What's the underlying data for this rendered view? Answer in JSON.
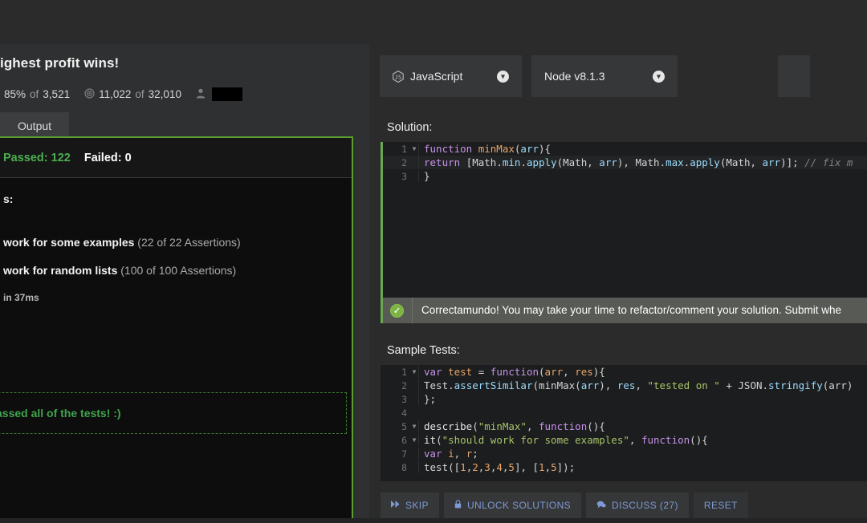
{
  "kata": {
    "title_truncated": "ighest profit wins!",
    "stats": {
      "completion_icon": "thumbs-up-icon",
      "completion": "85%",
      "completion_of": "of",
      "completion_total": "3,521",
      "rank_icon": "target-icon",
      "rank_value": "11,022",
      "rank_of": "of",
      "rank_total": "32,010",
      "user_icon": "person-icon",
      "user_name_redacted": ""
    }
  },
  "left_panel": {
    "tabs": [
      {
        "label": "Output",
        "active": true
      }
    ],
    "summary": {
      "passed_label": "Passed: 122",
      "failed_label": "Failed: 0"
    },
    "results_heading_truncated": "s:",
    "results": [
      {
        "name_truncated": "work for some examples",
        "assertions": "(22 of 22 Assertions)"
      },
      {
        "name_truncated": "work for random lists",
        "assertions": "(100 of 100 Assertions)"
      }
    ],
    "time_truncated": "in 37ms",
    "success_message_truncated": "assed all of the tests! :)"
  },
  "right_panel": {
    "selectors": [
      {
        "icon": "javascript-icon",
        "label": "JavaScript",
        "chevron": "chevron-down-icon"
      },
      {
        "icon": "",
        "label": "Node v8.1.3",
        "chevron": "chevron-down-icon"
      }
    ],
    "solution_label": "Solution:",
    "samples_label": "Sample Tests:",
    "solution_code": [
      {
        "num": "1",
        "fold": true,
        "highlight": false,
        "tokens": [
          {
            "t": "function ",
            "c": "k"
          },
          {
            "t": "minMax",
            "c": "nm"
          },
          {
            "t": "(",
            "c": "pn"
          },
          {
            "t": "arr",
            "c": "fn"
          },
          {
            "t": "){",
            "c": "pn"
          }
        ]
      },
      {
        "num": "2",
        "fold": false,
        "highlight": true,
        "tokens": [
          {
            "t": "  return ",
            "c": "k"
          },
          {
            "t": "[Math",
            "c": "pn"
          },
          {
            "t": ".",
            "c": "pn"
          },
          {
            "t": "min",
            "c": "fn"
          },
          {
            "t": ".",
            "c": "pn"
          },
          {
            "t": "apply",
            "c": "fn"
          },
          {
            "t": "(Math, ",
            "c": "pn"
          },
          {
            "t": "arr",
            "c": "fn"
          },
          {
            "t": "), Math",
            "c": "pn"
          },
          {
            "t": ".",
            "c": "pn"
          },
          {
            "t": "max",
            "c": "fn"
          },
          {
            "t": ".",
            "c": "pn"
          },
          {
            "t": "apply",
            "c": "fn"
          },
          {
            "t": "(Math, ",
            "c": "pn"
          },
          {
            "t": "arr",
            "c": "fn"
          },
          {
            "t": ")]; ",
            "c": "pn"
          },
          {
            "t": "// fix m",
            "c": "cm"
          }
        ]
      },
      {
        "num": "3",
        "fold": false,
        "highlight": false,
        "tokens": [
          {
            "t": "}",
            "c": "pn"
          }
        ]
      }
    ],
    "correct_message_truncated": "Correctamundo! You may take your time to refactor/comment your solution. Submit whe",
    "correct_icon": "check-circle-icon",
    "sample_code": [
      {
        "num": "1",
        "fold": true,
        "highlight": false,
        "tokens": [
          {
            "t": "var ",
            "c": "k"
          },
          {
            "t": "test",
            "c": "nm"
          },
          {
            "t": " = ",
            "c": "pn"
          },
          {
            "t": "function",
            "c": "k"
          },
          {
            "t": "(",
            "c": "pn"
          },
          {
            "t": "arr",
            "c": "nm"
          },
          {
            "t": ", ",
            "c": "pn"
          },
          {
            "t": "res",
            "c": "nm"
          },
          {
            "t": "){",
            "c": "pn"
          }
        ]
      },
      {
        "num": "2",
        "fold": false,
        "highlight": false,
        "tokens": [
          {
            "t": "  Test",
            "c": "pn"
          },
          {
            "t": ".",
            "c": "pn"
          },
          {
            "t": "assertSimilar",
            "c": "fn"
          },
          {
            "t": "(minMax(",
            "c": "pn"
          },
          {
            "t": "arr",
            "c": "fn"
          },
          {
            "t": "), ",
            "c": "pn"
          },
          {
            "t": "res",
            "c": "fn"
          },
          {
            "t": ", ",
            "c": "pn"
          },
          {
            "t": "\"tested on \"",
            "c": "st"
          },
          {
            "t": " + JSON",
            "c": "pn"
          },
          {
            "t": ".",
            "c": "pn"
          },
          {
            "t": "stringify",
            "c": "fn"
          },
          {
            "t": "(arr)",
            "c": "pn"
          }
        ]
      },
      {
        "num": "3",
        "fold": false,
        "highlight": false,
        "tokens": [
          {
            "t": "};",
            "c": "pn"
          }
        ]
      },
      {
        "num": "4",
        "fold": false,
        "highlight": false,
        "tokens": [
          {
            "t": "",
            "c": "pn"
          }
        ]
      },
      {
        "num": "5",
        "fold": true,
        "highlight": false,
        "tokens": [
          {
            "t": "describe",
            "c": "id"
          },
          {
            "t": "(",
            "c": "pn"
          },
          {
            "t": "\"minMax\"",
            "c": "st"
          },
          {
            "t": ", ",
            "c": "pn"
          },
          {
            "t": "function",
            "c": "k"
          },
          {
            "t": "(){",
            "c": "pn"
          }
        ]
      },
      {
        "num": "6",
        "fold": true,
        "highlight": false,
        "tokens": [
          {
            "t": "  it",
            "c": "id"
          },
          {
            "t": "(",
            "c": "pn"
          },
          {
            "t": "\"should work for some examples\"",
            "c": "st"
          },
          {
            "t": ", ",
            "c": "pn"
          },
          {
            "t": "function",
            "c": "k"
          },
          {
            "t": "(){",
            "c": "pn"
          }
        ]
      },
      {
        "num": "7",
        "fold": false,
        "highlight": false,
        "tokens": [
          {
            "t": "    var ",
            "c": "k"
          },
          {
            "t": "i",
            "c": "nm"
          },
          {
            "t": ", ",
            "c": "pn"
          },
          {
            "t": "r",
            "c": "nm"
          },
          {
            "t": ";",
            "c": "pn"
          }
        ]
      },
      {
        "num": "8",
        "fold": false,
        "highlight": false,
        "tokens": [
          {
            "t": "    test([",
            "c": "pn"
          },
          {
            "t": "1",
            "c": "nm"
          },
          {
            "t": ",",
            "c": "pn"
          },
          {
            "t": "2",
            "c": "nm"
          },
          {
            "t": ",",
            "c": "pn"
          },
          {
            "t": "3",
            "c": "nm"
          },
          {
            "t": ",",
            "c": "pn"
          },
          {
            "t": "4",
            "c": "nm"
          },
          {
            "t": ",",
            "c": "pn"
          },
          {
            "t": "5",
            "c": "nm"
          },
          {
            "t": "], [",
            "c": "pn"
          },
          {
            "t": "1",
            "c": "nm"
          },
          {
            "t": ",",
            "c": "pn"
          },
          {
            "t": "5",
            "c": "nm"
          },
          {
            "t": "]);",
            "c": "pn"
          }
        ]
      }
    ],
    "toolbar": [
      {
        "icon": "fast-forward-icon",
        "glyph": "▸▸",
        "label": "SKIP"
      },
      {
        "icon": "lock-icon",
        "glyph": "🔒",
        "label": "UNLOCK SOLUTIONS"
      },
      {
        "icon": "chat-icon",
        "glyph": "💬",
        "label": "DISCUSS (27)"
      },
      {
        "icon": "",
        "glyph": "",
        "label": "RESET"
      }
    ]
  },
  "colors": {
    "accent_green": "#5c9e31",
    "pass_green": "#4caf50",
    "button_blue": "#7e9ad6",
    "panel_bg": "#2b2b2b",
    "editor_bg": "#1c1d1e"
  }
}
